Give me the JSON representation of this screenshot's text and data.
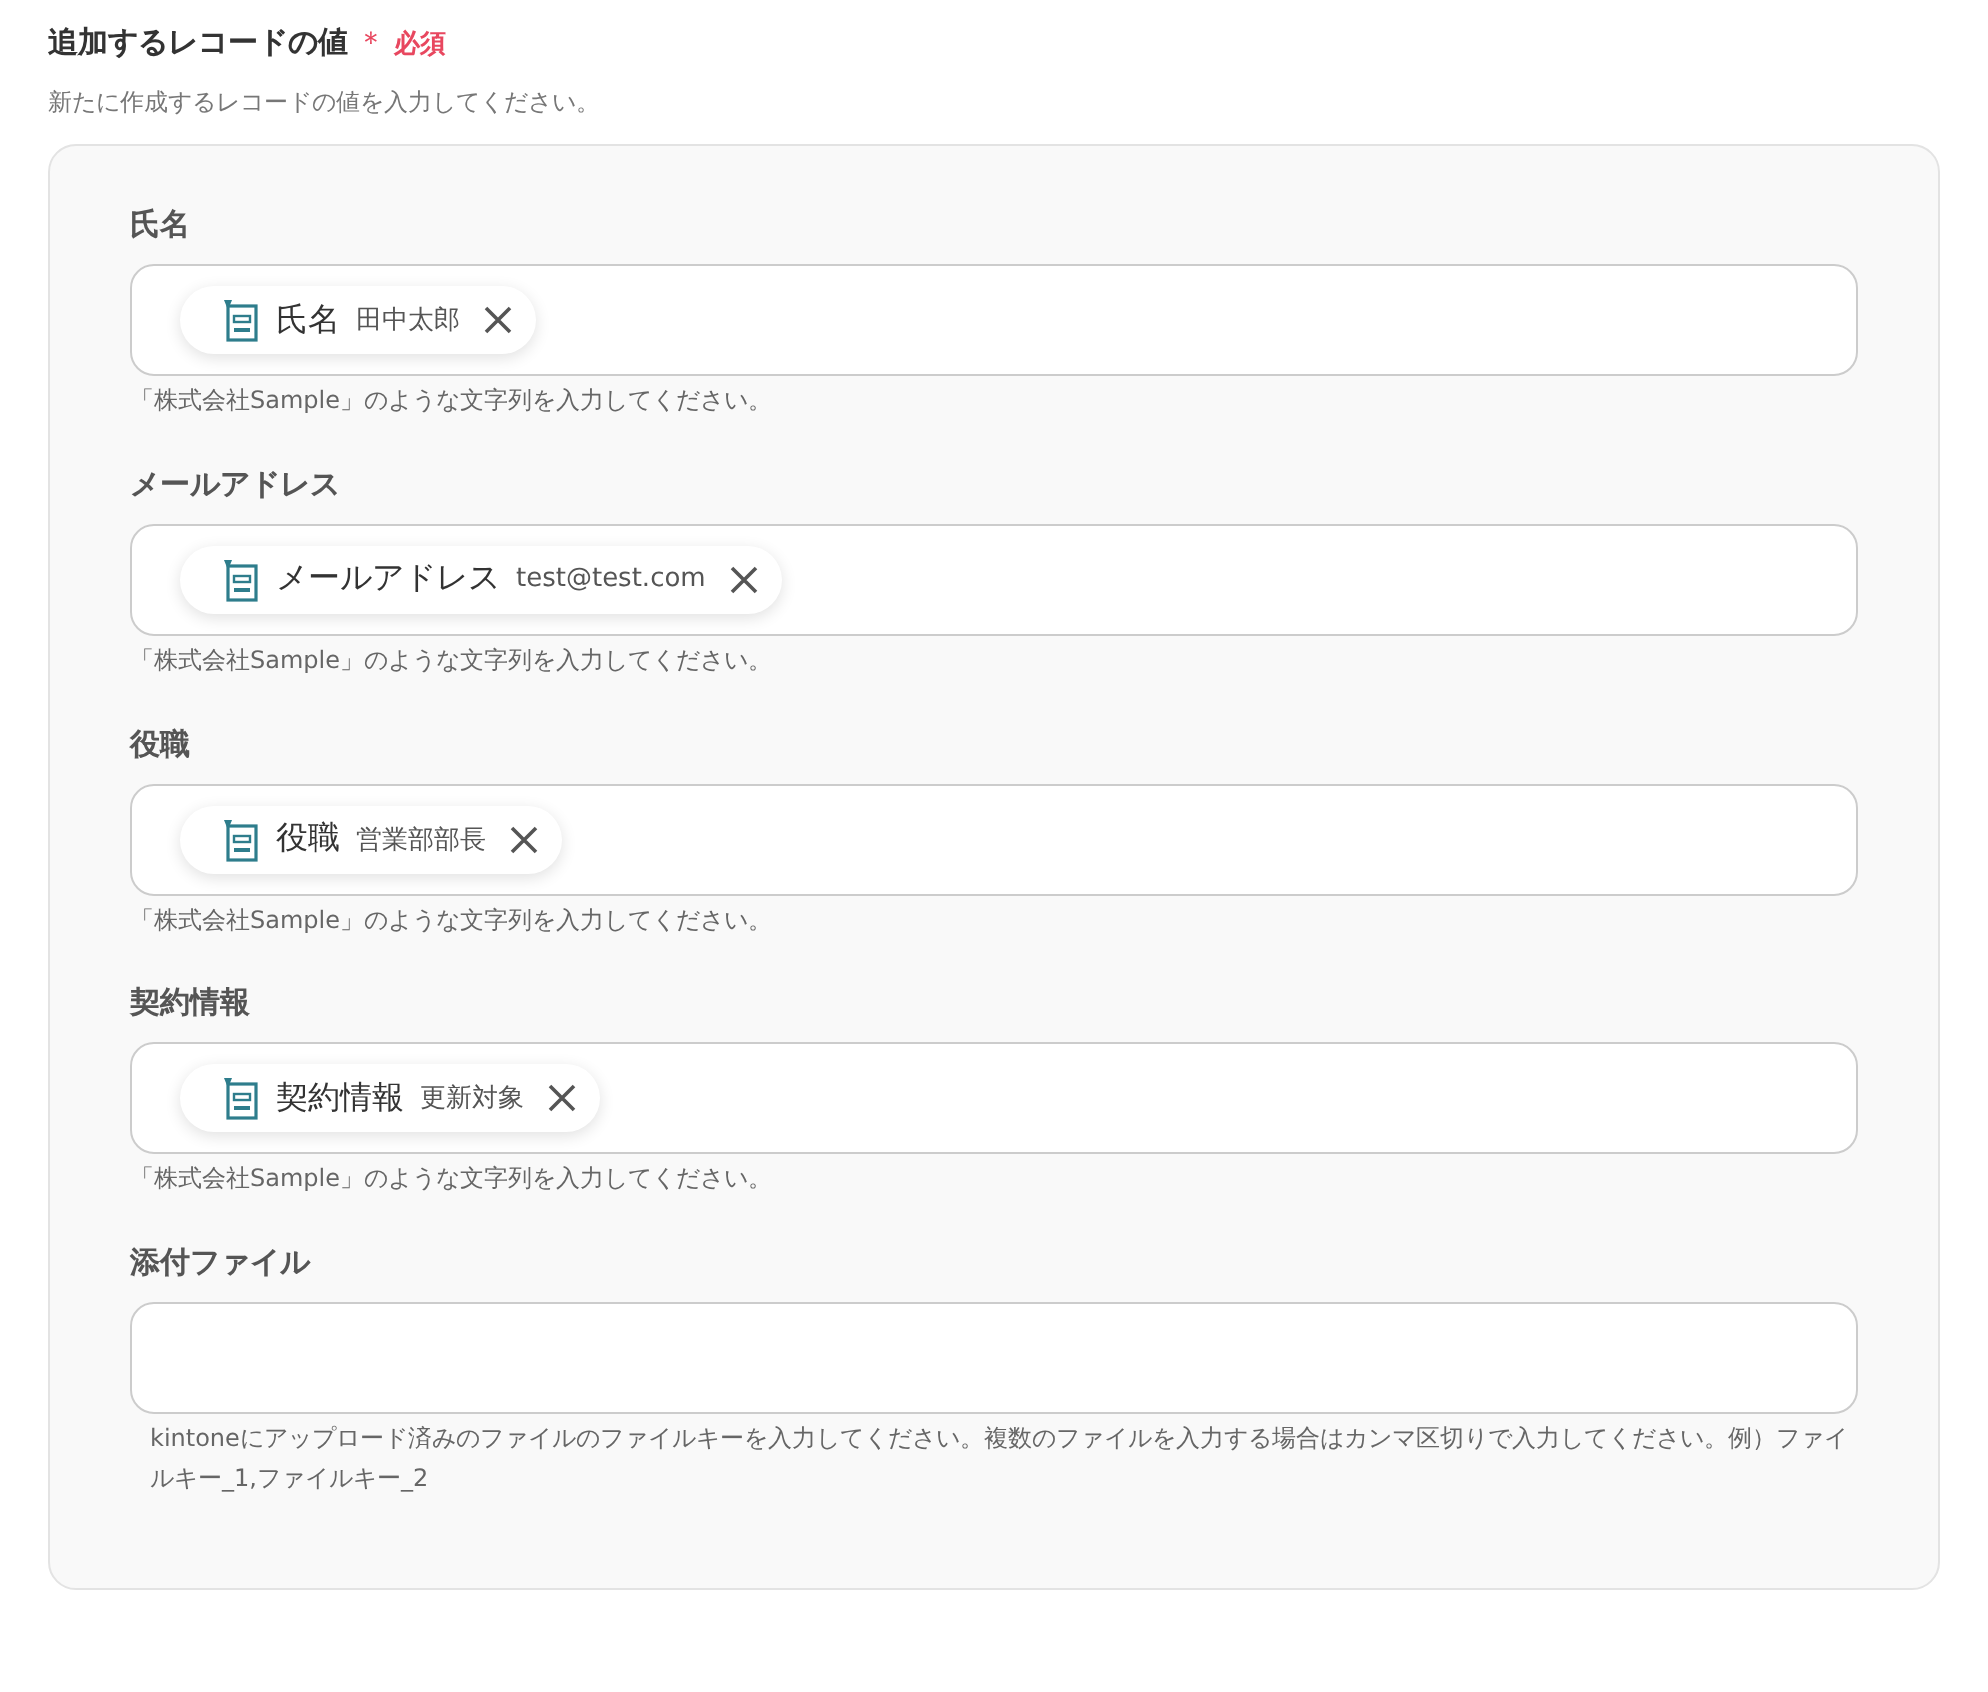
{
  "section": {
    "title": "追加するレコードの値",
    "required_mark": "＊",
    "required_label": "必須",
    "description": "新たに作成するレコードの値を入力してください。"
  },
  "fields": [
    {
      "label": "氏名",
      "chips": [
        {
          "name": "氏名",
          "value": "田中太郎"
        }
      ],
      "help": "「株式会社Sample」のような文字列を入力してください。"
    },
    {
      "label": "メールアドレス",
      "chips": [
        {
          "name": "メールアドレス",
          "value": "test@test.com"
        }
      ],
      "help": "「株式会社Sample」のような文字列を入力してください。"
    },
    {
      "label": "役職",
      "chips": [
        {
          "name": "役職",
          "value": "営業部部長"
        }
      ],
      "help": "「株式会社Sample」のような文字列を入力してください。"
    },
    {
      "label": "契約情報",
      "chips": [
        {
          "name": "契約情報",
          "value": "更新対象"
        }
      ],
      "help": "「株式会社Sample」のような文字列を入力してください。"
    },
    {
      "label": "添付ファイル",
      "help": "kintoneにアップロード済みのファイルのファイルキーを入力してください。複数のファイルを入力する場合はカンマ区切りで入力してください。例）ファイルキー_1,ファイルキー_2"
    }
  ]
}
